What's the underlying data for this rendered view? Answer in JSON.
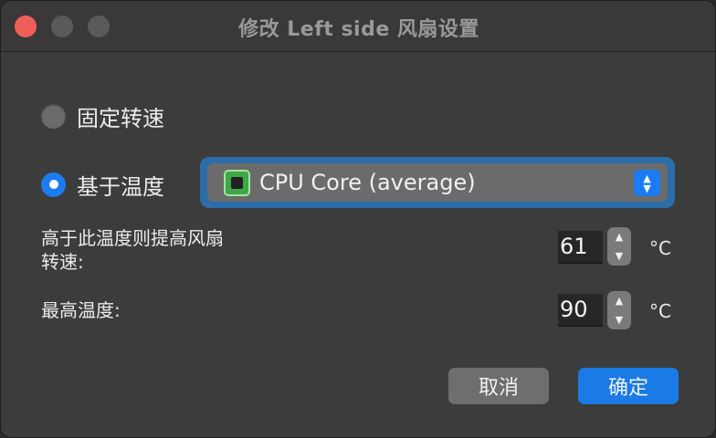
{
  "window": {
    "title": "修改 Left side 风扇设置"
  },
  "mode": {
    "fixed_label": "固定转速",
    "sensor_label": "基于温度",
    "selected": "sensor"
  },
  "sensor_select": {
    "value": "CPU Core (average)",
    "icon": "cpu-chip-icon"
  },
  "speed_threshold": {
    "label_line1": "高于此温度则提高风扇",
    "label_line2": "转速:",
    "value": "61",
    "unit": "°C"
  },
  "max_temp": {
    "label": "最高温度:",
    "value": "90",
    "unit": "°C"
  },
  "buttons": {
    "cancel": "取消",
    "ok": "确定"
  },
  "colors": {
    "accent": "#1a7cf0",
    "close": "#ee5f57",
    "focus_ring": "#2b6da8"
  }
}
